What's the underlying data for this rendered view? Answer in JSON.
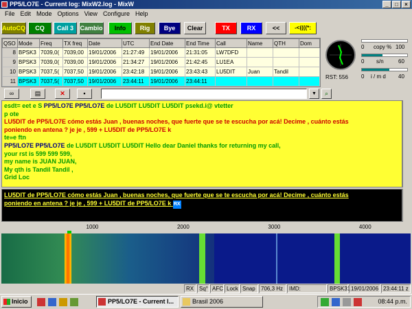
{
  "window": {
    "title": "PP5/LO7E - Current log: MixW2.log - MixW"
  },
  "menu": [
    "File",
    "Edit",
    "Mode",
    "Options",
    "View",
    "Configure",
    "Help"
  ],
  "toolbar": {
    "autocq": "AutoCQ",
    "cq": "CQ",
    "call3": "Call 3",
    "cambio": "Cambio",
    "info": "Info",
    "rig": "Rig",
    "bye": "Bye",
    "clear": "Clear",
    "tx": "TX",
    "rx": "RX",
    "back": "<<",
    "tune": "-<((((*:"
  },
  "log": {
    "columns": [
      "QSO",
      "Mode",
      "Freq",
      "TX freq",
      "Date",
      "UTC",
      "End Date",
      "End Time",
      "Call",
      "Name",
      "QTH",
      "Dom"
    ],
    "rows": [
      [
        "8",
        "BPSK3",
        "7039,0(",
        "7039,00",
        "19/01/2006",
        "21:27:49",
        "19/01/2006",
        "21:31:05",
        "LW7DFD",
        "",
        "",
        ""
      ],
      [
        "9",
        "BPSK3",
        "7039,0(",
        "7039,00",
        "19/01/2006",
        "21:34:27",
        "19/01/2006",
        "21:42:45",
        "LU1EA",
        "",
        "",
        ""
      ],
      [
        "10",
        "BPSK3",
        "7037,5(",
        "7037,50",
        "19/01/2006",
        "23:42:18",
        "19/01/2006",
        "23:43:43",
        "LU5DIT",
        "Juan",
        "Tandil",
        ""
      ],
      [
        "11",
        "BPSK3",
        "7037,5(",
        "7037,50",
        "19/01/2006",
        "23:44:11",
        "19/01/2006",
        "23:44:11",
        "",
        "",
        "",
        ""
      ]
    ]
  },
  "meters": {
    "copy_value": "0",
    "copy_label": "copy %",
    "copy_max": "100",
    "copy_pct": 0.0,
    "sn_value": "0",
    "sn_label": "s/n",
    "sn_max": "60",
    "sn_pct": 0.45,
    "imd_value": "0",
    "imd_label": "i / m d",
    "imd_max": "40",
    "imd_pct": 0.6,
    "rst": "RST: 556"
  },
  "rx_lines": [
    [
      {
        "t": "esdt=   eet e S  ",
        "c": "green"
      },
      {
        "t": "PP5/LO7E PP5/LO7E ",
        "c": "navy"
      },
      {
        "t": "de LU5DIT LU5DIT LU5DIT psekd.i@  vtetter",
        "c": "green"
      }
    ],
    [
      {
        "t": "p ote",
        "c": "green"
      }
    ],
    [
      {
        "t": "LU5DIT de PP5/LO7E cómo estás Juan , buenas noches, que fuerte que se te escucha por acá! Decime , cuánto estás",
        "c": "red"
      }
    ],
    [
      {
        "t": "poniendo en antena ?  je je , 599 +    LU5DIT de PP5/LO7E k",
        "c": "red"
      }
    ],
    [
      {
        "t": " te»e ftn",
        "c": "green"
      }
    ],
    [
      {
        "t": "   PP5/LO7E PP5/LO7E ",
        "c": "navy"
      },
      {
        "t": "de LU5DIT LU5DIT LU5DIT Hello dear Daniel thanks for returning my call,",
        "c": "green"
      }
    ],
    [
      {
        "t": " your rst is 599 599 599,",
        "c": "green"
      }
    ],
    [
      {
        "t": "my name is  JUAN JUAN,",
        "c": "green"
      }
    ],
    [
      {
        "t": "My qth is Tandil Tandil ,",
        "c": "green"
      }
    ],
    [
      {
        "t": "Grid Loc",
        "c": "green"
      }
    ]
  ],
  "tx_lines": [
    "LU5DIT de PP5/LO7E cómo estás Juan , buenas noches, que fuerte que se te escucha por acá! Decime , cuánto estás",
    "poniendo en antena ?  je je , 599 +    LU5DIT de PP5/LO7E k"
  ],
  "tx_cursor": "RX",
  "waterfall": {
    "ticks": [
      "1000",
      "2000",
      "3000",
      "4000"
    ]
  },
  "status": {
    "rx": "RX",
    "sq": "Sq°",
    "afc": "AFC",
    "lock": "Lock",
    "snap": "Snap",
    "freq": "706,3 Hz",
    "imd": "IMD:",
    "mode": "BPSK31",
    "date": "19/01/2006",
    "time": "23:44:11 z"
  },
  "taskbar": {
    "start": "Inicio",
    "tasks": [
      "PP5/LO7E - Current l...",
      "Brasil 2006"
    ],
    "clock": "08:44 p.m."
  },
  "colors": {
    "rx_background": "#ffff33",
    "tx_background": "#000000",
    "selected_row": "#00ffff",
    "waterfall_background": "#0a1a8a",
    "signal_trace": "#ffaa00"
  }
}
